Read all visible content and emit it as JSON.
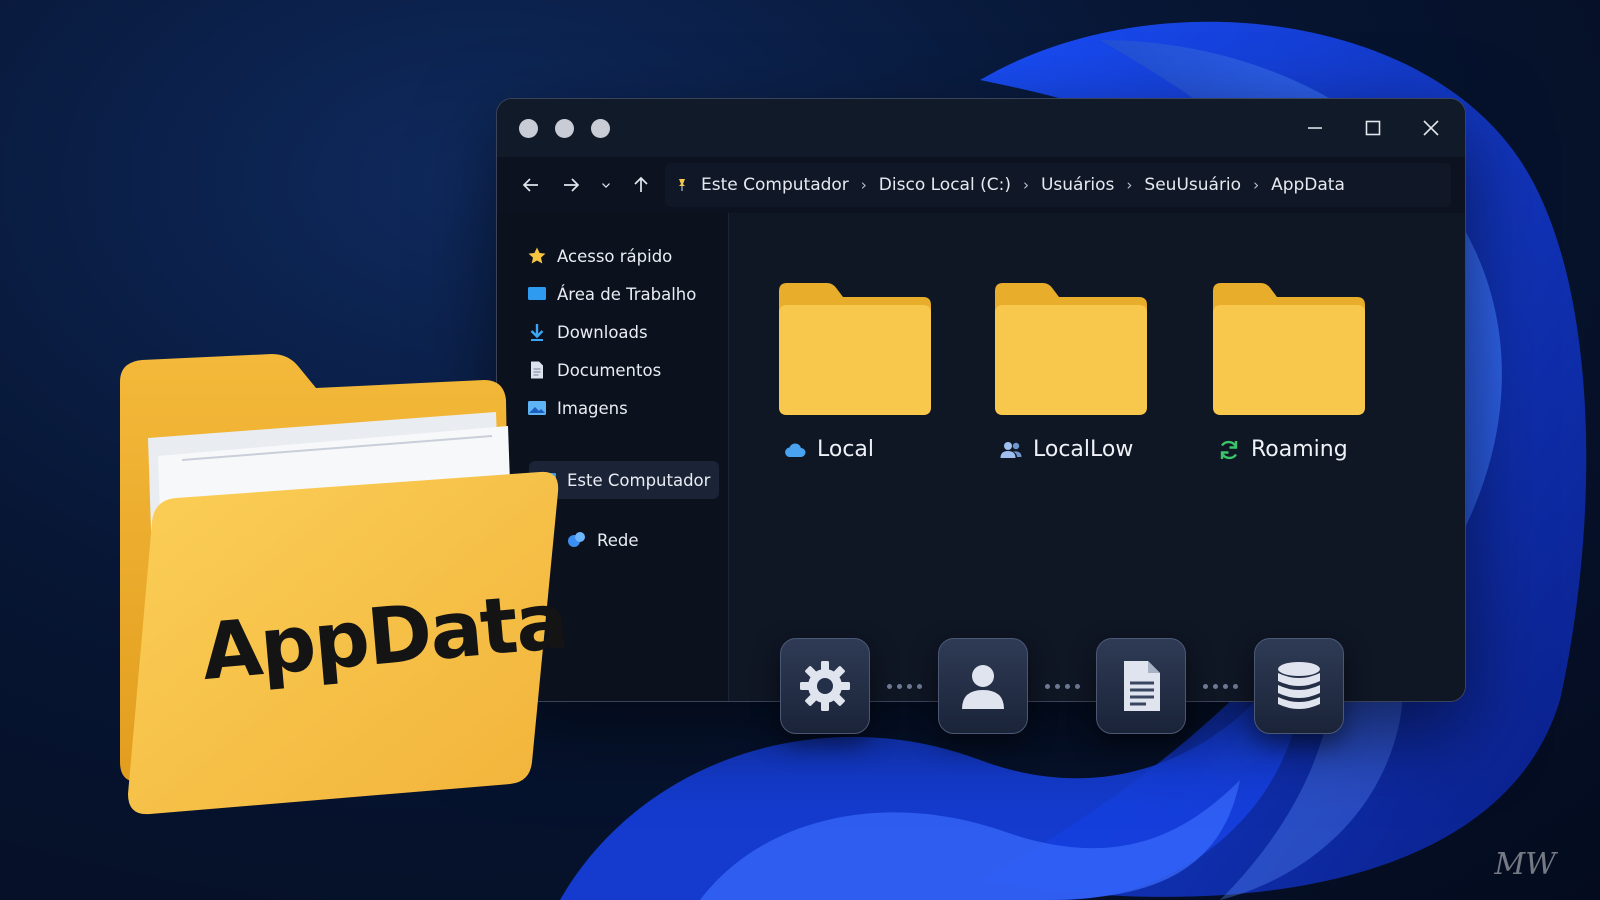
{
  "window": {
    "title_dots": [
      "close-dot",
      "minimize-dot",
      "zoom-dot"
    ],
    "controls": {
      "minimize": "—",
      "maximize": "☐",
      "close": "✕"
    }
  },
  "nav": {
    "breadcrumb": [
      "Este Computador",
      "Disco Local (C:)",
      "Usuários",
      "SeuUsuário",
      "AppData"
    ]
  },
  "sidebar": {
    "items": [
      {
        "label": "Acesso rápido",
        "icon": "star-icon"
      },
      {
        "label": "Área de Trabalho",
        "icon": "desktop-icon"
      },
      {
        "label": "Downloads",
        "icon": "download-icon"
      },
      {
        "label": "Documentos",
        "icon": "document-icon"
      },
      {
        "label": "Imagens",
        "icon": "image-icon"
      },
      {
        "label": "Este Computador",
        "icon": "computer-icon"
      },
      {
        "label": "Rede",
        "icon": "network-icon"
      }
    ]
  },
  "folders": [
    {
      "label": "Local",
      "icon": "cloud-icon",
      "icon_color": "#4aa3f0"
    },
    {
      "label": "LocalLow",
      "icon": "users-icon",
      "icon_color": "#8fb4e8"
    },
    {
      "label": "Roaming",
      "icon": "sync-icon",
      "icon_color": "#3cc46a"
    }
  ],
  "icon_strip": [
    "gear-icon",
    "user-icon",
    "file-icon",
    "database-icon"
  ],
  "big_folder": {
    "label": "AppData"
  },
  "watermark": "MW",
  "colors": {
    "folder_yellow": "#f6c445",
    "accent_blue": "#2a6df5",
    "window_bg": "#0f1624"
  }
}
